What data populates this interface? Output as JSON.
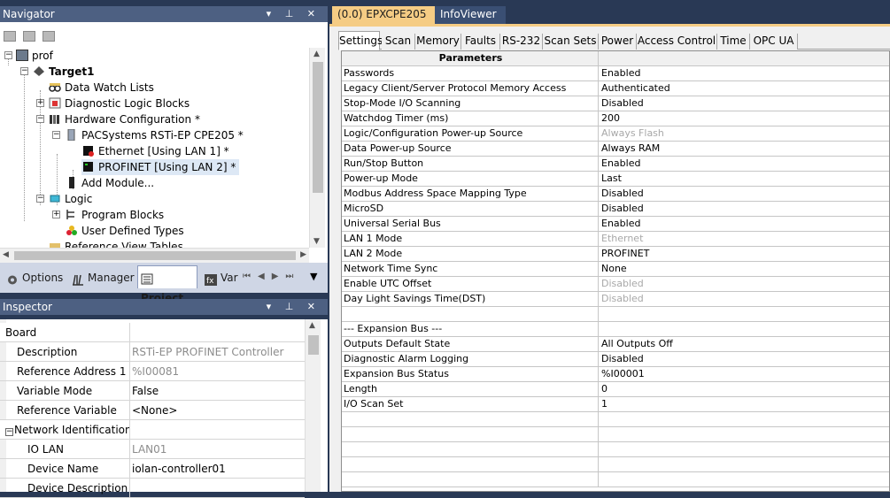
{
  "navigator": {
    "title": "Navigator",
    "tree": [
      {
        "label": "prof",
        "icon": "project-icon"
      },
      {
        "label": "Target1",
        "icon": "target-icon"
      },
      {
        "label": "Data Watch Lists",
        "icon": "glasses-icon"
      },
      {
        "label": "Diagnostic Logic Blocks",
        "icon": "diag-block-icon"
      },
      {
        "label": "Hardware Configuration *",
        "icon": "hardware-icon"
      },
      {
        "label": "PACSystems RSTi-EP CPE205 *",
        "icon": "cpu-icon"
      },
      {
        "label": "Ethernet [Using LAN 1] *",
        "icon": "ethernet-disabled-icon"
      },
      {
        "label": "PROFINET [Using LAN 2] *",
        "icon": "profinet-icon"
      },
      {
        "label": "Add Module...",
        "icon": "module-icon"
      },
      {
        "label": "Logic",
        "icon": "logic-icon"
      },
      {
        "label": "Program Blocks",
        "icon": "program-blocks-icon"
      },
      {
        "label": "User Defined Types",
        "icon": "udt-icon"
      },
      {
        "label": "Reference View Tables",
        "icon": "folder-icon"
      }
    ],
    "tabs": [
      {
        "label": "Options",
        "icon": "gear-icon"
      },
      {
        "label": "Manager",
        "icon": "books-icon"
      },
      {
        "label": "Project",
        "icon": "project-tab-icon"
      },
      {
        "label": "Var",
        "icon": "fx-icon"
      }
    ]
  },
  "inspector": {
    "title": "Inspector",
    "rows": [
      {
        "name": "Board",
        "value": ""
      },
      {
        "name": "Description",
        "value": "RSTi-EP PROFINET Controller"
      },
      {
        "name": "Reference Address 1",
        "value": "%I00081"
      },
      {
        "name": "Variable Mode",
        "value": "False"
      },
      {
        "name": "Reference Variable",
        "value": "<None>"
      },
      {
        "name": "Network Identification",
        "value": ""
      },
      {
        "name": "IO LAN",
        "value": "LAN01"
      },
      {
        "name": "Device Name",
        "value": "iolan-controller01"
      },
      {
        "name": "Device Description",
        "value": ""
      }
    ]
  },
  "document": {
    "tabs": [
      {
        "label": "(0.0) EPXCPE205"
      },
      {
        "label": "InfoViewer"
      }
    ],
    "close_glyph": "✕",
    "settings_tabs": [
      "Settings",
      "Scan",
      "Memory",
      "Faults",
      "RS-232",
      "Scan Sets",
      "Power",
      "Access Control",
      "Time",
      "OPC UA"
    ],
    "grid": {
      "header": "Parameters",
      "rows": [
        {
          "name": "Passwords",
          "value": "Enabled"
        },
        {
          "name": "Legacy Client/Server Protocol Memory Access",
          "value": "Authenticated"
        },
        {
          "name": "Stop-Mode I/O Scanning",
          "value": "Disabled"
        },
        {
          "name": "Watchdog Timer (ms)",
          "value": "200"
        },
        {
          "name": "Logic/Configuration Power-up Source",
          "value": "Always Flash"
        },
        {
          "name": "Data Power-up Source",
          "value": "Always RAM"
        },
        {
          "name": "Run/Stop Button",
          "value": "Enabled"
        },
        {
          "name": "Power-up Mode",
          "value": "Last"
        },
        {
          "name": "Modbus Address Space Mapping Type",
          "value": "Disabled"
        },
        {
          "name": "MicroSD",
          "value": "Disabled"
        },
        {
          "name": "Universal Serial Bus",
          "value": "Enabled"
        },
        {
          "name": "LAN 1 Mode",
          "value": "Ethernet"
        },
        {
          "name": "LAN 2 Mode",
          "value": "PROFINET"
        },
        {
          "name": "Network Time Sync",
          "value": "None"
        },
        {
          "name": "Enable UTC Offset",
          "value": "Disabled"
        },
        {
          "name": "Day Light Savings Time(DST)",
          "value": "Disabled"
        },
        {
          "name": "",
          "value": ""
        },
        {
          "name": "--- Expansion Bus ---",
          "value": ""
        },
        {
          "name": "Outputs Default State",
          "value": " All Outputs Off"
        },
        {
          "name": "Diagnostic Alarm Logging",
          "value": "Disabled"
        },
        {
          "name": "Expansion Bus Status",
          "value": "%I00001"
        },
        {
          "name": "Length",
          "value": "0"
        },
        {
          "name": "I/O Scan Set",
          "value": "1"
        },
        {
          "name": "",
          "value": ""
        },
        {
          "name": "",
          "value": ""
        },
        {
          "name": "",
          "value": ""
        },
        {
          "name": "",
          "value": ""
        },
        {
          "name": "",
          "value": ""
        }
      ]
    }
  },
  "colors": {
    "title_bar": "#4d6082",
    "active_doc_tab": "#f5cc84",
    "background": "#293955"
  }
}
